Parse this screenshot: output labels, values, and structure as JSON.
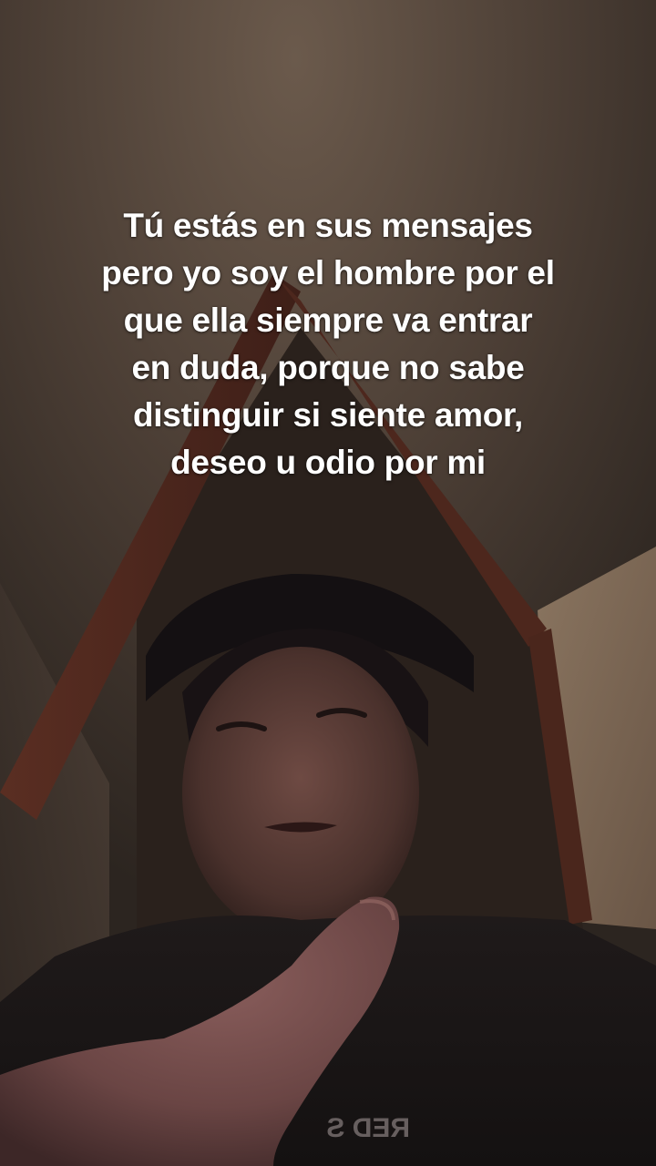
{
  "caption": {
    "lines": [
      "Tú estás en sus mensajes",
      "pero yo soy el hombre por el",
      "que ella siempre va entrar",
      "en duda, porque no sabe",
      "distinguir si siente amor,",
      "deseo u odio por mi"
    ]
  },
  "shirt_print": "RED S"
}
